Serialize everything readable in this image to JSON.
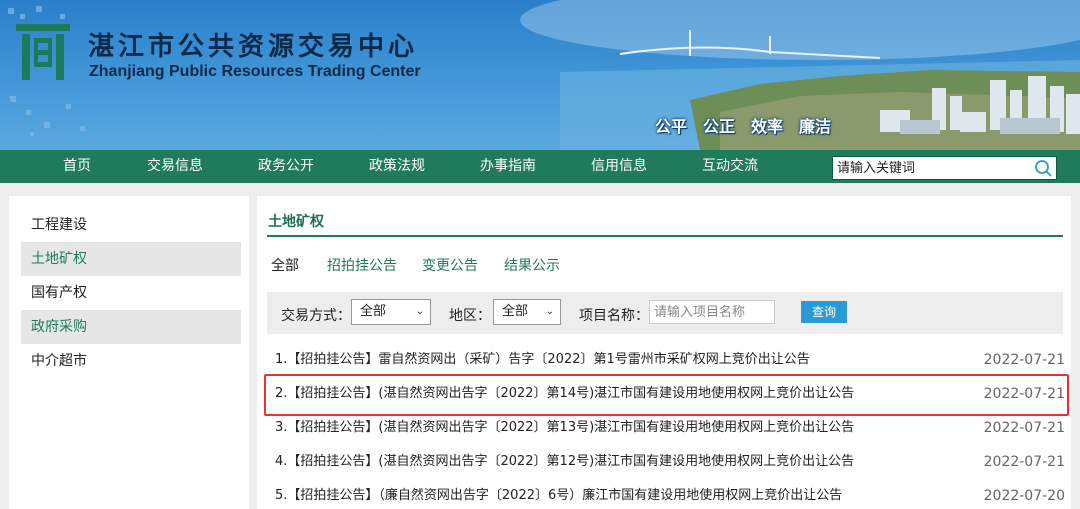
{
  "header": {
    "title": "湛江市公共资源交易中心",
    "subtitle": "Zhanjiang Public Resources Trading Center",
    "slogans": [
      "公平",
      "公正",
      "效率",
      "廉洁"
    ]
  },
  "nav": {
    "items": [
      "首页",
      "交易信息",
      "政务公开",
      "政策法规",
      "办事指南",
      "信用信息",
      "互动交流"
    ],
    "search_placeholder": "请输入关键词"
  },
  "sidebar": {
    "items": [
      "工程建设",
      "土地矿权",
      "国有产权",
      "政府采购",
      "中介超市"
    ]
  },
  "main": {
    "title": "土地矿权",
    "tabs": [
      "全部",
      "招拍挂公告",
      "变更公告",
      "结果公示"
    ],
    "filter": {
      "trade_label": "交易方式：",
      "trade_value": "全部",
      "region_label": "地区：",
      "region_value": "全部",
      "project_label": "项目名称：",
      "project_placeholder": "请输入项目名称",
      "query_button": "查询"
    },
    "list": [
      {
        "title": "1.【招拍挂公告】雷自然资网出（采矿）告字〔2022〕第1号雷州市采矿权网上竞价出让公告",
        "date": "2022-07-21"
      },
      {
        "title": "2.【招拍挂公告】(湛自然资网出告字〔2022〕第14号)湛江市国有建设用地使用权网上竞价出让公告",
        "date": "2022-07-21"
      },
      {
        "title": "3.【招拍挂公告】(湛自然资网出告字〔2022〕第13号)湛江市国有建设用地使用权网上竞价出让公告",
        "date": "2022-07-21"
      },
      {
        "title": "4.【招拍挂公告】(湛自然资网出告字〔2022〕第12号)湛江市国有建设用地使用权网上竞价出让公告",
        "date": "2022-07-21"
      },
      {
        "title": "5.【招拍挂公告】（廉自然资网出告字〔2022〕6号）廉江市国有建设用地使用权网上竞价出让公告",
        "date": "2022-07-20"
      }
    ]
  },
  "colors": {
    "nav_green": "#1f7b5c",
    "header_blue": "#3e93d6",
    "highlight_red": "#e63333",
    "button_blue": "#2a9ad6"
  }
}
